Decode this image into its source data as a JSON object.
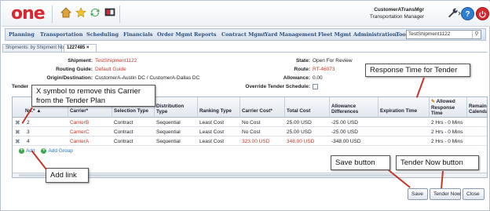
{
  "header": {
    "logo": "one",
    "user_name": "CustomerATransMgr",
    "user_role": "Transportation Manager",
    "icons": [
      "home-icon",
      "favorites-star-icon",
      "refresh-icon",
      "screen-icon",
      "wrench-icon",
      "help-icon",
      "power-icon"
    ],
    "help_glyph": "?",
    "brand_color": "#d8282f"
  },
  "nav": {
    "items": [
      "Planning",
      "Transportation",
      "Scheduling",
      "Financials",
      "Order Mgmt",
      "Reports",
      "Contract Mgmt",
      "Yard Management",
      "Fleet Mgmt",
      "Administration",
      "Tools"
    ],
    "search_value": "TestShipment1122"
  },
  "tabs": [
    {
      "label": "Shipments: by Shipment No"
    },
    {
      "label": "1227485"
    }
  ],
  "form": {
    "shipment_label": "Shipment:",
    "shipment_value": "TestShipment1122",
    "routing_label": "Routing Guide:",
    "routing_value": "Default Guide",
    "od_label": "Origin/Destination:",
    "od_value": "CustomerA-Austin DC / CustomerA-Dallas DC",
    "tender_label": "Tender",
    "state_label": "State:",
    "state_value": "Open For Review",
    "route_label": "Route:",
    "route_value": "RT-46073",
    "allowance_label": "Allowance:",
    "allowance_value": "0.00",
    "override_label": "Override Tender Schedule:"
  },
  "grid": {
    "headers": {
      "no": "No.*",
      "carrier": "Carrier*",
      "selection_type": "Selection Type",
      "distribution_type": "Distribution Type",
      "ranking_type": "Ranking Type",
      "carrier_cost": "Carrier Cost*",
      "total_cost": "Total Cost",
      "allowance_diff": "Allowance Differences",
      "expiration_time": "Expiration Time",
      "allowed_response_time": "Allowed Response Time",
      "remaining": "Remain Calenda"
    },
    "rows": [
      {
        "no": "2",
        "carrier": "CarrierB",
        "selection_type": "Contract",
        "distribution_type": "Sequential",
        "ranking_type": "Least Cost",
        "carrier_cost": "No Cost",
        "total_cost": "25.00 USD",
        "allowance_diff": "-25.00 USD",
        "expiration_time": "",
        "allowed_response_time": "2 Hrs - 0 Mins"
      },
      {
        "no": "3",
        "carrier": "CarrierC",
        "selection_type": "Contract",
        "distribution_type": "Sequential",
        "ranking_type": "Least Cost",
        "carrier_cost": "No Cost",
        "total_cost": "25.00 USD",
        "allowance_diff": "-25.00 USD",
        "expiration_time": "",
        "allowed_response_time": "2 Hrs - 0 Mins"
      },
      {
        "no": "4",
        "carrier": "CarrierA",
        "selection_type": "Contract",
        "distribution_type": "Sequential",
        "ranking_type": "Least Cost",
        "carrier_cost": "323.00 USD",
        "total_cost": "348.00 USD",
        "allowance_diff": "-348.00 USD",
        "expiration_time": "",
        "allowed_response_time": "2 Hrs - 0 Mins"
      }
    ],
    "add_label": "Add",
    "add_group_label": "Add Group"
  },
  "buttons": {
    "save": "Save",
    "tender_now": "Tender Now",
    "close": "Close"
  },
  "callouts": {
    "remove_carrier": "X symbol to remove this Carrier from the Tender Plan",
    "remove_carrier_line1": "X symbol to remove this Carrier",
    "remove_carrier_line2": "from the Tender Plan",
    "response_time": "Response Time for Tender",
    "add_link": "Add link",
    "save_button": "Save button",
    "tender_now_button": "Tender Now button"
  },
  "colors": {
    "link_red": "#c0392b",
    "nav_text": "#2d4f7c",
    "arrow": "#c0392b"
  }
}
